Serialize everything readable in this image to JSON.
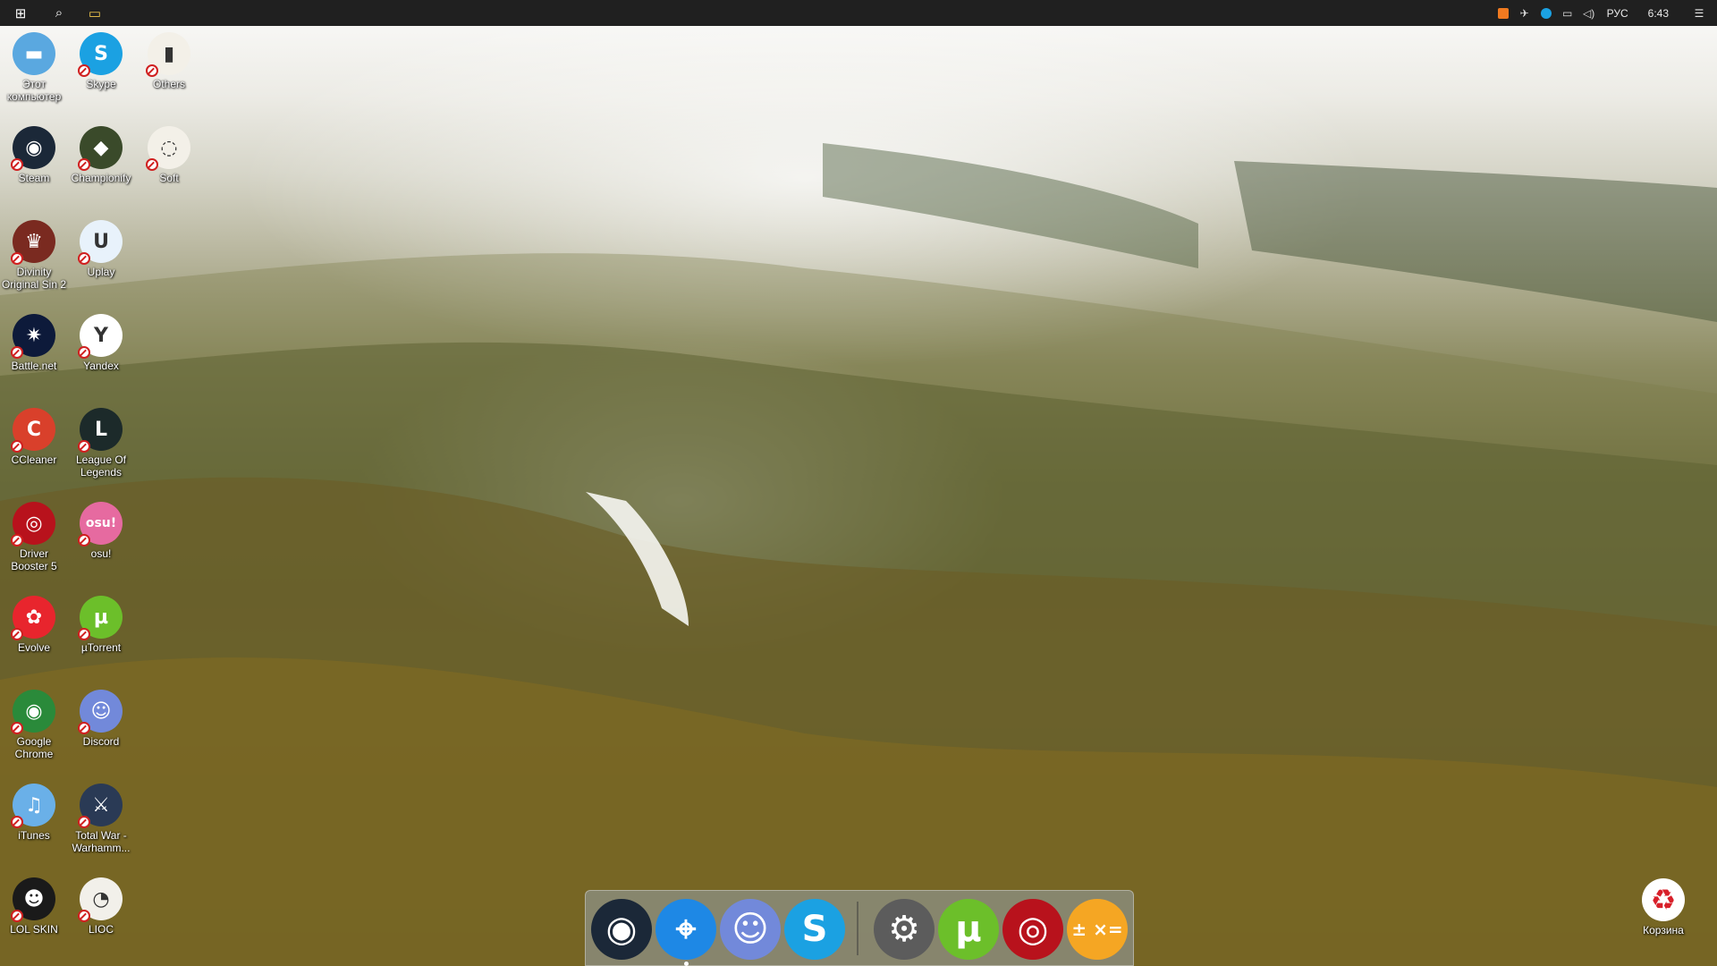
{
  "taskbar": {
    "start_glyph": "⊞",
    "search_glyph": "⌕",
    "explorer_glyph": "▭",
    "language": "РУС",
    "time": "6:43",
    "notifications_glyph": "☰"
  },
  "desktop_icons": [
    {
      "label": "Этот компьютер",
      "glyph": "▬",
      "color": "#5aa8e0"
    },
    {
      "label": "Skype",
      "glyph": "S",
      "color": "#1ba1e2"
    },
    {
      "label": "Others",
      "glyph": "▮",
      "color": "#f3f0e8"
    },
    {
      "label": "Steam",
      "glyph": "◉",
      "color": "#1b2838"
    },
    {
      "label": "Championify",
      "glyph": "◆",
      "color": "#3a4a2a"
    },
    {
      "label": "Soft",
      "glyph": "◌",
      "color": "#f3f0e8"
    },
    {
      "label": "Divinity Original Sin 2",
      "glyph": "♛",
      "color": "#7a2a20"
    },
    {
      "label": "Uplay",
      "glyph": "U",
      "color": "#e8f2fb"
    },
    {
      "label": "Battle.net",
      "glyph": "✷",
      "color": "#0d1a3a"
    },
    {
      "label": "Yandex",
      "glyph": "Y",
      "color": "#ffffff"
    },
    {
      "label": "CCleaner",
      "glyph": "C",
      "color": "#d9402b"
    },
    {
      "label": "League Of Legends",
      "glyph": "L",
      "color": "#1c2a2a"
    },
    {
      "label": "Driver Booster 5",
      "glyph": "◎",
      "color": "#b8121c"
    },
    {
      "label": "osu!",
      "glyph": "osu!",
      "color": "#e66aa0"
    },
    {
      "label": "Evolve",
      "glyph": "✿",
      "color": "#e8252d"
    },
    {
      "label": "µTorrent",
      "glyph": "µ",
      "color": "#6cbf2a"
    },
    {
      "label": "Google Chrome",
      "glyph": "◉",
      "color": "#2a8a3a"
    },
    {
      "label": "Discord",
      "glyph": "☺",
      "color": "#7289da"
    },
    {
      "label": "iTunes",
      "glyph": "♫",
      "color": "#6ab0e8"
    },
    {
      "label": "Total War - Warhamm...",
      "glyph": "⚔",
      "color": "#2a3a55"
    },
    {
      "label": "LOL SKIN",
      "glyph": "☻",
      "color": "#1a1a1a"
    },
    {
      "label": "LIOC",
      "glyph": "◔",
      "color": "#f2f0ea"
    }
  ],
  "dock": [
    {
      "name": "steam",
      "glyph": "◉",
      "color": "#1b2838"
    },
    {
      "name": "safari",
      "glyph": "⌖",
      "color": "#1e88e5"
    },
    {
      "name": "discord",
      "glyph": "☺",
      "color": "#7289da"
    },
    {
      "name": "skype",
      "glyph": "S",
      "color": "#1ba1e2"
    },
    {
      "name": "settings",
      "glyph": "⚙",
      "color": "#5c5c5c"
    },
    {
      "name": "utorrent",
      "glyph": "µ",
      "color": "#6cbf2a"
    },
    {
      "name": "driver-booster",
      "glyph": "◎",
      "color": "#b8121c"
    },
    {
      "name": "calculator",
      "glyph": "± ×=",
      "color": "#f5a623"
    }
  ],
  "recycle_bin": {
    "label": "Корзина",
    "glyph": "♻"
  }
}
